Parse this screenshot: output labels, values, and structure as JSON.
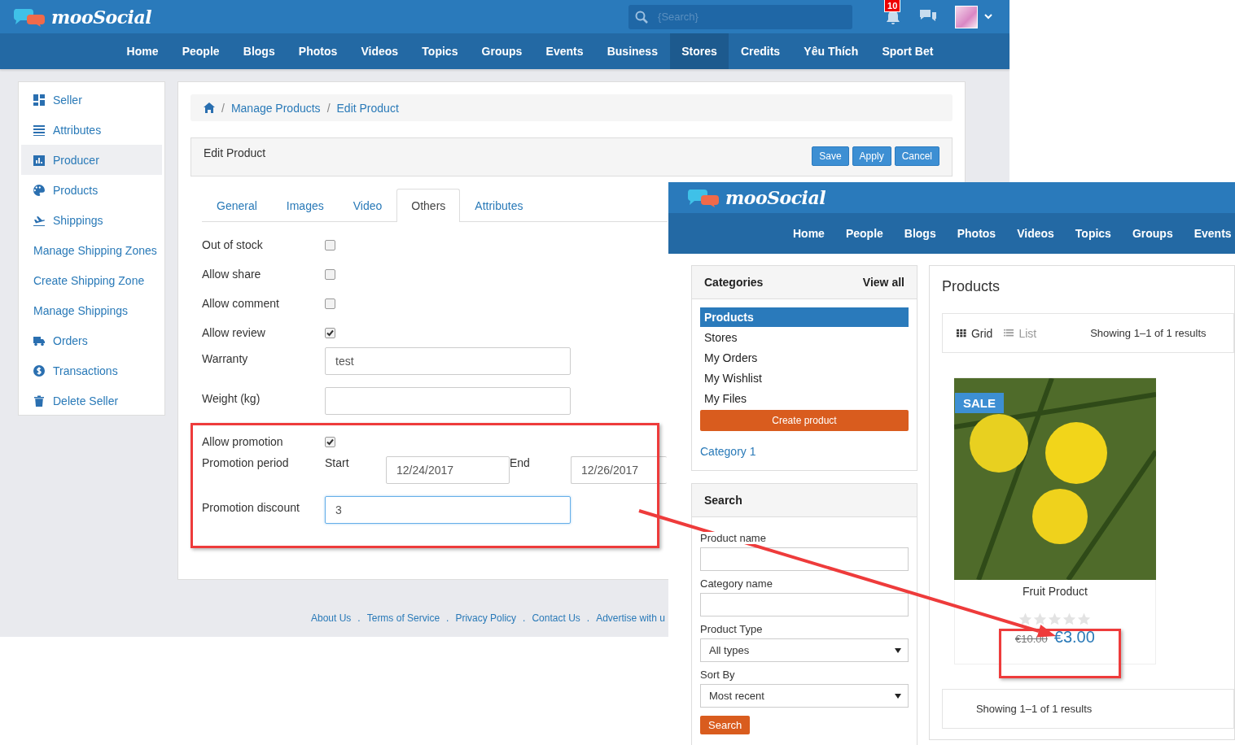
{
  "left": {
    "logo": "mooSocial",
    "search": {
      "placeholder": "{Search}"
    },
    "notifications": "10",
    "nav": [
      {
        "label": "Home",
        "selected": false
      },
      {
        "label": "People",
        "selected": false
      },
      {
        "label": "Blogs",
        "selected": false
      },
      {
        "label": "Photos",
        "selected": false
      },
      {
        "label": "Videos",
        "selected": false
      },
      {
        "label": "Topics",
        "selected": false
      },
      {
        "label": "Groups",
        "selected": false
      },
      {
        "label": "Events",
        "selected": false
      },
      {
        "label": "Business",
        "selected": false
      },
      {
        "label": "Stores",
        "selected": true
      },
      {
        "label": "Credits",
        "selected": false
      },
      {
        "label": "Yêu Thích",
        "selected": false
      },
      {
        "label": "Sport Bet",
        "selected": false
      }
    ],
    "sidebar": [
      {
        "label": "Seller",
        "kind": "grid",
        "selected": false
      },
      {
        "label": "Attributes",
        "kind": "lines",
        "selected": false
      },
      {
        "label": "Producer",
        "kind": "chart",
        "selected": true
      },
      {
        "label": "Products",
        "kind": "palette",
        "selected": false
      },
      {
        "label": "Shippings",
        "kind": "plane",
        "selected": false
      },
      {
        "label": "Manage Shipping Zones",
        "kind": "plain",
        "selected": false
      },
      {
        "label": "Create Shipping Zone",
        "kind": "plain",
        "selected": false
      },
      {
        "label": "Manage Shippings",
        "kind": "plain",
        "selected": false
      },
      {
        "label": "Orders",
        "kind": "truck",
        "selected": false
      },
      {
        "label": "Transactions",
        "kind": "dollar",
        "selected": false
      },
      {
        "label": "Delete Seller",
        "kind": "trash",
        "selected": false
      }
    ],
    "breadcrumb": [
      {
        "separator": "/",
        "label": "Manage Products"
      },
      {
        "separator": "/",
        "label": "Edit Product"
      }
    ],
    "panel_title": "Edit Product",
    "buttons": [
      "Save",
      "Apply",
      "Cancel"
    ],
    "tabs": [
      {
        "label": "General",
        "selected": false
      },
      {
        "label": "Images",
        "selected": false
      },
      {
        "label": "Video",
        "selected": false
      },
      {
        "label": "Others",
        "selected": true
      },
      {
        "label": "Attributes",
        "selected": false
      }
    ],
    "form": [
      {
        "kind": "checkbox",
        "label": "Out of stock",
        "checked": false
      },
      {
        "kind": "checkbox",
        "label": "Allow share",
        "checked": false
      },
      {
        "kind": "checkbox",
        "label": "Allow comment",
        "checked": false
      },
      {
        "kind": "checkbox",
        "label": "Allow review",
        "checked": true
      },
      {
        "kind": "text",
        "label": "Warranty",
        "value": "test"
      },
      {
        "kind": "text",
        "label": "Weight (kg)"
      },
      {
        "kind": "checkbox",
        "label": "Allow promotion",
        "checked": true
      },
      {
        "kind": "period",
        "label": "Promotion period",
        "start_label": "Start",
        "start": "12/24/2017",
        "end_label": "End",
        "end": "12/26/2017"
      },
      {
        "kind": "text",
        "label": "Promotion discount",
        "value": "3",
        "focused": true
      }
    ],
    "footer": [
      {
        "label": "About Us"
      },
      {
        "separator": ".",
        "label": "Terms of Service"
      },
      {
        "separator": ".",
        "label": "Privacy Policy"
      },
      {
        "separator": ".",
        "label": "Contact Us"
      },
      {
        "separator": ".",
        "label": "Advertise with u"
      }
    ]
  },
  "right": {
    "logo": "mooSocial",
    "nav": [
      "Home",
      "People",
      "Blogs",
      "Photos",
      "Videos",
      "Topics",
      "Groups",
      "Events"
    ],
    "categories": {
      "title": "Categories",
      "view_all": "View all",
      "items": [
        {
          "label": "Products",
          "selected": true
        },
        {
          "label": "Stores",
          "selected": false
        },
        {
          "label": "My Orders",
          "selected": false
        },
        {
          "label": "My Wishlist",
          "selected": false
        },
        {
          "label": "My Files",
          "selected": false
        }
      ],
      "create_button": "Create product",
      "category_link": "Category 1"
    },
    "search": {
      "title": "Search",
      "fields": [
        {
          "kind": "text",
          "label": "Product name"
        },
        {
          "kind": "text",
          "label": "Category name"
        },
        {
          "kind": "select",
          "label": "Product Type",
          "value": "All types"
        },
        {
          "kind": "select",
          "label": "Sort By",
          "value": "Most recent"
        }
      ],
      "button": "Search"
    },
    "products": {
      "title": "Products",
      "views": [
        {
          "label": "Grid",
          "kind": "grid",
          "selected": true
        },
        {
          "label": "List",
          "kind": "list",
          "selected": false
        }
      ],
      "summary": "Showing 1–1 of 1 results",
      "items": [
        {
          "badge": "SALE",
          "name": "Fruit Product",
          "stars": 0,
          "old_price": "€10.00",
          "price": "€3.00"
        }
      ],
      "footer_summary": "Showing 1–1 of 1 results"
    }
  }
}
